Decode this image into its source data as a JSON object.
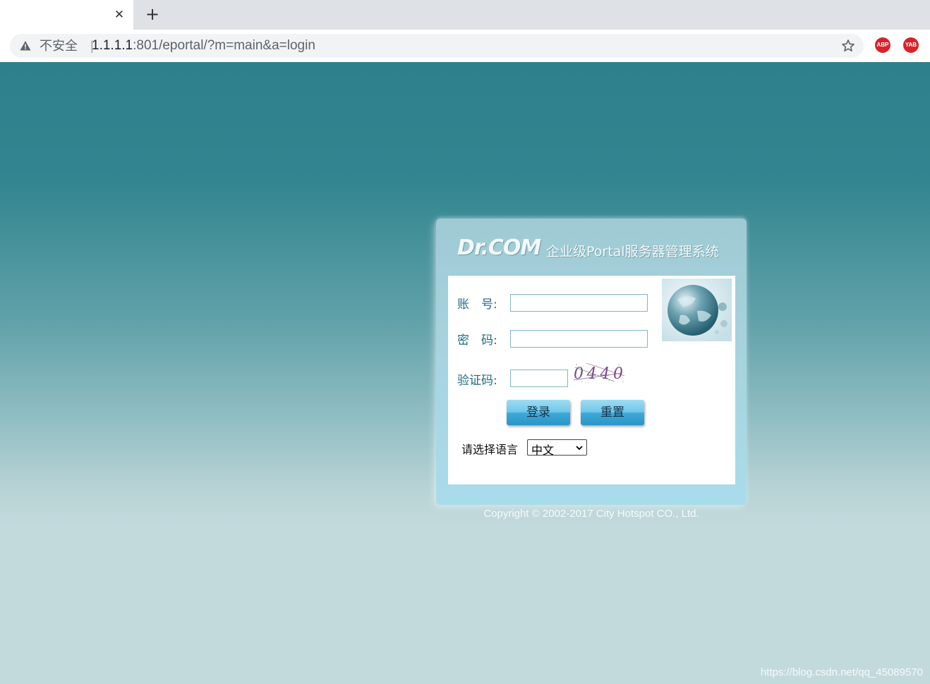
{
  "browser": {
    "tab_close": "✕",
    "new_tab": "+",
    "security_label": "不安全",
    "separator": "|",
    "url_host": "1.1.1.1",
    "url_rest": ":801/eportal/?m=main&a=login",
    "extensions": [
      "ABP",
      "YAB"
    ]
  },
  "header": {
    "logo": "Dr.COM",
    "subtitle": "企业级Portal服务器管理系统"
  },
  "form": {
    "account_label": "账　号:",
    "password_label": "密　码:",
    "captcha_label": "验证码:",
    "account_value": "",
    "password_value": "",
    "captcha_value": "",
    "captcha_text": "0440",
    "login_button": "登录",
    "reset_button": "重置",
    "language_label": "请选择语言",
    "language_selected": "中文"
  },
  "footer": {
    "copyright": "Copyright © 2002-2017 City Hotspot CO., Ltd."
  },
  "watermark": "https://blog.csdn.net/qq_45089570",
  "colors": {
    "label": "#236b84",
    "button_top": "#9fdcf2",
    "button_bottom": "#2a95c7",
    "extension": "#d8232a"
  }
}
